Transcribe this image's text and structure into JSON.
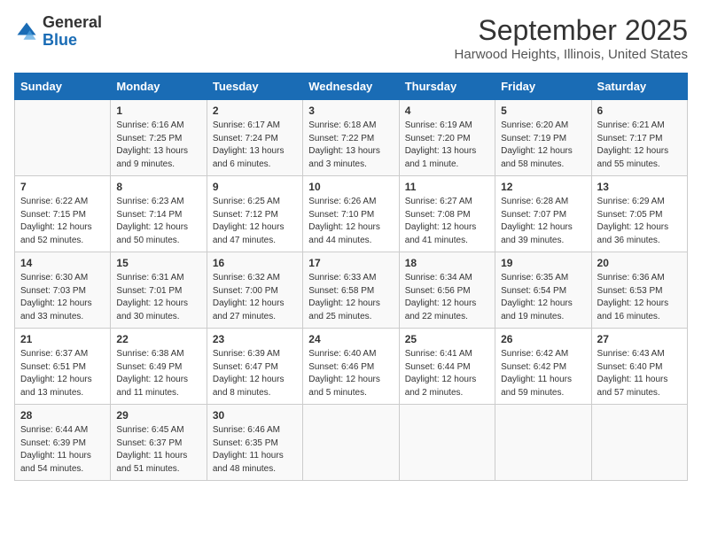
{
  "header": {
    "logo_line1": "General",
    "logo_line2": "Blue",
    "title": "September 2025",
    "subtitle": "Harwood Heights, Illinois, United States"
  },
  "days_of_week": [
    "Sunday",
    "Monday",
    "Tuesday",
    "Wednesday",
    "Thursday",
    "Friday",
    "Saturday"
  ],
  "weeks": [
    [
      {
        "day": "",
        "info": ""
      },
      {
        "day": "1",
        "info": "Sunrise: 6:16 AM\nSunset: 7:25 PM\nDaylight: 13 hours\nand 9 minutes."
      },
      {
        "day": "2",
        "info": "Sunrise: 6:17 AM\nSunset: 7:24 PM\nDaylight: 13 hours\nand 6 minutes."
      },
      {
        "day": "3",
        "info": "Sunrise: 6:18 AM\nSunset: 7:22 PM\nDaylight: 13 hours\nand 3 minutes."
      },
      {
        "day": "4",
        "info": "Sunrise: 6:19 AM\nSunset: 7:20 PM\nDaylight: 13 hours\nand 1 minute."
      },
      {
        "day": "5",
        "info": "Sunrise: 6:20 AM\nSunset: 7:19 PM\nDaylight: 12 hours\nand 58 minutes."
      },
      {
        "day": "6",
        "info": "Sunrise: 6:21 AM\nSunset: 7:17 PM\nDaylight: 12 hours\nand 55 minutes."
      }
    ],
    [
      {
        "day": "7",
        "info": "Sunrise: 6:22 AM\nSunset: 7:15 PM\nDaylight: 12 hours\nand 52 minutes."
      },
      {
        "day": "8",
        "info": "Sunrise: 6:23 AM\nSunset: 7:14 PM\nDaylight: 12 hours\nand 50 minutes."
      },
      {
        "day": "9",
        "info": "Sunrise: 6:25 AM\nSunset: 7:12 PM\nDaylight: 12 hours\nand 47 minutes."
      },
      {
        "day": "10",
        "info": "Sunrise: 6:26 AM\nSunset: 7:10 PM\nDaylight: 12 hours\nand 44 minutes."
      },
      {
        "day": "11",
        "info": "Sunrise: 6:27 AM\nSunset: 7:08 PM\nDaylight: 12 hours\nand 41 minutes."
      },
      {
        "day": "12",
        "info": "Sunrise: 6:28 AM\nSunset: 7:07 PM\nDaylight: 12 hours\nand 39 minutes."
      },
      {
        "day": "13",
        "info": "Sunrise: 6:29 AM\nSunset: 7:05 PM\nDaylight: 12 hours\nand 36 minutes."
      }
    ],
    [
      {
        "day": "14",
        "info": "Sunrise: 6:30 AM\nSunset: 7:03 PM\nDaylight: 12 hours\nand 33 minutes."
      },
      {
        "day": "15",
        "info": "Sunrise: 6:31 AM\nSunset: 7:01 PM\nDaylight: 12 hours\nand 30 minutes."
      },
      {
        "day": "16",
        "info": "Sunrise: 6:32 AM\nSunset: 7:00 PM\nDaylight: 12 hours\nand 27 minutes."
      },
      {
        "day": "17",
        "info": "Sunrise: 6:33 AM\nSunset: 6:58 PM\nDaylight: 12 hours\nand 25 minutes."
      },
      {
        "day": "18",
        "info": "Sunrise: 6:34 AM\nSunset: 6:56 PM\nDaylight: 12 hours\nand 22 minutes."
      },
      {
        "day": "19",
        "info": "Sunrise: 6:35 AM\nSunset: 6:54 PM\nDaylight: 12 hours\nand 19 minutes."
      },
      {
        "day": "20",
        "info": "Sunrise: 6:36 AM\nSunset: 6:53 PM\nDaylight: 12 hours\nand 16 minutes."
      }
    ],
    [
      {
        "day": "21",
        "info": "Sunrise: 6:37 AM\nSunset: 6:51 PM\nDaylight: 12 hours\nand 13 minutes."
      },
      {
        "day": "22",
        "info": "Sunrise: 6:38 AM\nSunset: 6:49 PM\nDaylight: 12 hours\nand 11 minutes."
      },
      {
        "day": "23",
        "info": "Sunrise: 6:39 AM\nSunset: 6:47 PM\nDaylight: 12 hours\nand 8 minutes."
      },
      {
        "day": "24",
        "info": "Sunrise: 6:40 AM\nSunset: 6:46 PM\nDaylight: 12 hours\nand 5 minutes."
      },
      {
        "day": "25",
        "info": "Sunrise: 6:41 AM\nSunset: 6:44 PM\nDaylight: 12 hours\nand 2 minutes."
      },
      {
        "day": "26",
        "info": "Sunrise: 6:42 AM\nSunset: 6:42 PM\nDaylight: 11 hours\nand 59 minutes."
      },
      {
        "day": "27",
        "info": "Sunrise: 6:43 AM\nSunset: 6:40 PM\nDaylight: 11 hours\nand 57 minutes."
      }
    ],
    [
      {
        "day": "28",
        "info": "Sunrise: 6:44 AM\nSunset: 6:39 PM\nDaylight: 11 hours\nand 54 minutes."
      },
      {
        "day": "29",
        "info": "Sunrise: 6:45 AM\nSunset: 6:37 PM\nDaylight: 11 hours\nand 51 minutes."
      },
      {
        "day": "30",
        "info": "Sunrise: 6:46 AM\nSunset: 6:35 PM\nDaylight: 11 hours\nand 48 minutes."
      },
      {
        "day": "",
        "info": ""
      },
      {
        "day": "",
        "info": ""
      },
      {
        "day": "",
        "info": ""
      },
      {
        "day": "",
        "info": ""
      }
    ]
  ]
}
